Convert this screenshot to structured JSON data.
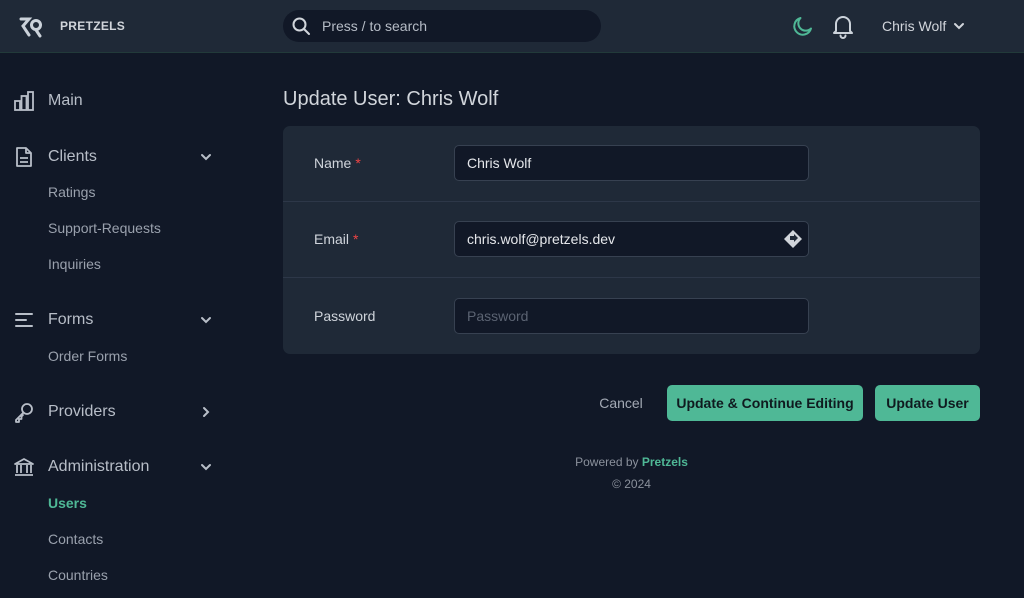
{
  "header": {
    "brand": "PRETZELS",
    "search_placeholder": "Press / to search",
    "user_name": "Chris Wolf",
    "accent_color": "#4fb896"
  },
  "sidebar": {
    "items": [
      {
        "label": "Main",
        "icon": "bar-chart-icon"
      },
      {
        "label": "Clients",
        "icon": "document-icon",
        "expanded": true,
        "children": [
          "Ratings",
          "Support-Requests",
          "Inquiries"
        ]
      },
      {
        "label": "Forms",
        "icon": "lines-icon",
        "expanded": true,
        "children": [
          "Order Forms"
        ]
      },
      {
        "label": "Providers",
        "icon": "key-icon",
        "expanded": false
      },
      {
        "label": "Administration",
        "icon": "bank-icon",
        "expanded": true,
        "children": [
          "Users",
          "Contacts",
          "Countries"
        ],
        "active_child": "Users"
      }
    ]
  },
  "main": {
    "title": "Update User: Chris Wolf",
    "fields": [
      {
        "label": "Name",
        "required": "*",
        "value": "Chris Wolf",
        "placeholder": ""
      },
      {
        "label": "Email",
        "required": "*",
        "value": "chris.wolf@pretzels.dev",
        "placeholder": ""
      },
      {
        "label": "Password",
        "required": "",
        "value": "",
        "placeholder": "Password"
      }
    ],
    "actions": {
      "cancel": "Cancel",
      "continue": "Update & Continue Editing",
      "submit": "Update User"
    }
  },
  "footer": {
    "powered_by": "Powered by",
    "brand": "Pretzels",
    "copyright": "© 2024"
  }
}
